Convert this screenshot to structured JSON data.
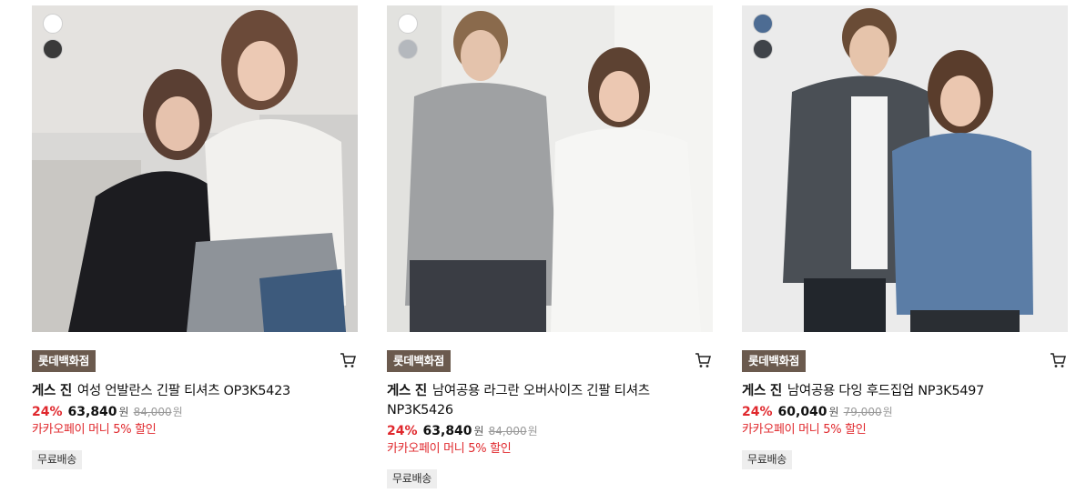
{
  "products": [
    {
      "swatches": [
        {
          "color": "#ffffff",
          "name": "white"
        },
        {
          "color": "#3a3a3a",
          "name": "black"
        }
      ],
      "image_alt": "product-photo-women-lounge",
      "store_badge": "롯데백화점",
      "brand": "게스 진",
      "name": "여성 언발란스 긴팔 티셔츠 OP3K5423",
      "discount": "24%",
      "price": "63,840",
      "price_unit": "원",
      "original_price": "84,000",
      "original_unit": "원",
      "promo": "카카오페이 머니 5% 할인",
      "shipping": "무료배송"
    },
    {
      "swatches": [
        {
          "color": "#ffffff",
          "name": "white"
        },
        {
          "color": "#b4b8bd",
          "name": "grey"
        }
      ],
      "image_alt": "product-photo-unisex-raglan",
      "store_badge": "롯데백화점",
      "brand": "게스 진",
      "name": "남여공용 라그란 오버사이즈 긴팔 티셔츠 NP3K5426",
      "discount": "24%",
      "price": "63,840",
      "price_unit": "원",
      "original_price": "84,000",
      "original_unit": "원",
      "promo": "카카오페이 머니 5% 할인",
      "shipping": "무료배송"
    },
    {
      "swatches": [
        {
          "color": "#4d6c93",
          "name": "blue"
        },
        {
          "color": "#3f4349",
          "name": "charcoal"
        }
      ],
      "image_alt": "product-photo-unisex-hoodie",
      "store_badge": "롯데백화점",
      "brand": "게스 진",
      "name": "남여공용 다잉 후드집업 NP3K5497",
      "discount": "24%",
      "price": "60,040",
      "price_unit": "원",
      "original_price": "79,000",
      "original_unit": "원",
      "promo": "카카오페이 머니 5% 할인",
      "shipping": "무료배송"
    }
  ],
  "colors": {
    "badge_bg": "#6b5a4e",
    "discount": "#e0282d",
    "shipping_bg": "#eeeeee"
  },
  "icons": {
    "cart": "shopping-cart-icon"
  }
}
